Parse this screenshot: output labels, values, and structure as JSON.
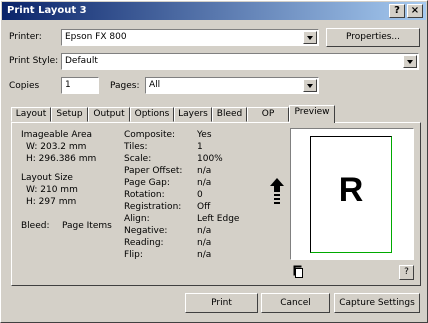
{
  "window": {
    "title": "Print Layout 3"
  },
  "titlebar_buttons": {
    "help": "?",
    "close": "×"
  },
  "printer": {
    "label": "Printer:",
    "value": "Epson FX 800",
    "properties_label": "Properties..."
  },
  "print_style": {
    "label": "Print Style:",
    "value": "Default"
  },
  "copies": {
    "label": "Copies",
    "value": "1"
  },
  "pages": {
    "label": "Pages:",
    "value": "All"
  },
  "tabs": [
    {
      "label": "Layout"
    },
    {
      "label": "Setup"
    },
    {
      "label": "Output"
    },
    {
      "label": "Options"
    },
    {
      "label": "Layers"
    },
    {
      "label": "Bleed"
    },
    {
      "label": "OP"
    },
    {
      "label": "Preview"
    }
  ],
  "active_tab": "Preview",
  "info": {
    "imageable_area_title": "Imageable Area",
    "imageable_w": "W: 203.2 mm",
    "imageable_h": "H: 296.386 mm",
    "layout_size_title": "Layout Size",
    "layout_w": "W: 210 mm",
    "layout_h": "H: 297 mm",
    "bleed_label": "Bleed:",
    "bleed_value": "Page Items"
  },
  "props": [
    {
      "key": "Composite:",
      "value": "Yes"
    },
    {
      "key": "Tiles:",
      "value": "1"
    },
    {
      "key": "Scale:",
      "value": "100%"
    },
    {
      "key": "Paper Offset:",
      "value": "n/a"
    },
    {
      "key": "Page Gap:",
      "value": "n/a"
    },
    {
      "key": "Rotation:",
      "value": "0"
    },
    {
      "key": "Registration:",
      "value": "Off"
    },
    {
      "key": "Align:",
      "value": "Left Edge"
    },
    {
      "key": "Negative:",
      "value": "n/a"
    },
    {
      "key": "Reading:",
      "value": "n/a"
    },
    {
      "key": "Flip:",
      "value": "n/a"
    }
  ],
  "preview": {
    "letter": "R",
    "help": "?"
  },
  "buttons": {
    "print": "Print",
    "cancel": "Cancel",
    "capture": "Capture Settings"
  }
}
